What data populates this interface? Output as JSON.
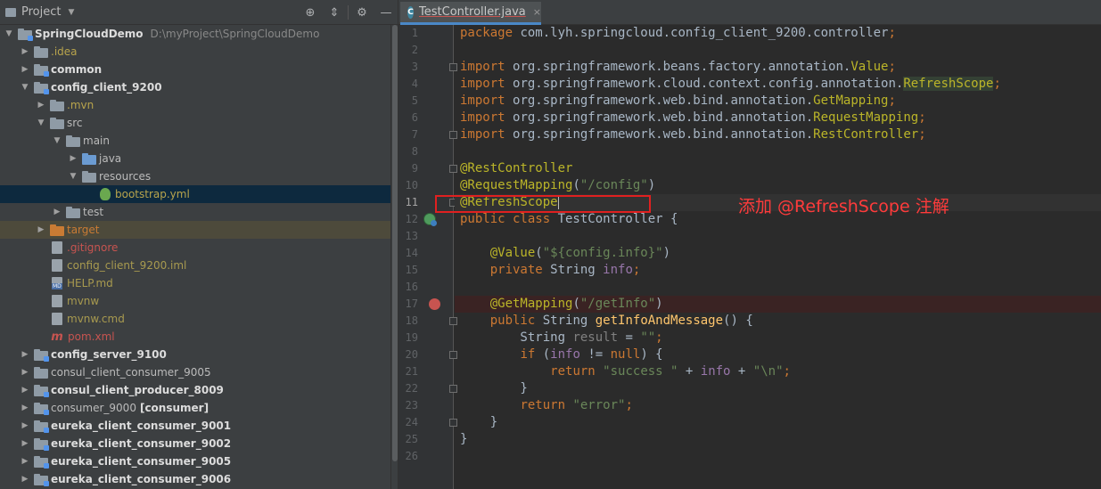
{
  "project": {
    "header_title": "Project",
    "header_dropdown": "▼",
    "tools": [
      "target-icon",
      "collapse-icon",
      "gear-icon",
      "hide-icon"
    ],
    "tree": [
      {
        "label": "SpringCloudDemo",
        "hint": "D:\\myProject\\SpringCloudDemo",
        "style": "bold",
        "arrow": "▼",
        "icon": "module-folder"
      },
      {
        "label": ".idea",
        "style": "yellow",
        "arrow": "▶",
        "icon": "folder"
      },
      {
        "label": "common",
        "style": "bold",
        "arrow": "▶",
        "icon": "module-folder"
      },
      {
        "label": "config_client_9200",
        "style": "bold",
        "arrow": "▼",
        "icon": "module-folder"
      },
      {
        "label": ".mvn",
        "style": "yellow",
        "arrow": "▶",
        "icon": "folder"
      },
      {
        "label": "src",
        "style": "normal",
        "arrow": "▼",
        "icon": "folder"
      },
      {
        "label": "main",
        "style": "normal",
        "arrow": "▼",
        "icon": "folder"
      },
      {
        "label": "java",
        "style": "normal",
        "arrow": "▶",
        "icon": "source-folder"
      },
      {
        "label": "resources",
        "style": "normal",
        "arrow": "▼",
        "icon": "resources-folder"
      },
      {
        "label": "bootstrap.yml",
        "style": "yellow",
        "arrow": "",
        "icon": "yml-file"
      },
      {
        "label": "test",
        "style": "normal",
        "arrow": "▶",
        "icon": "folder"
      },
      {
        "label": "target",
        "style": "orange",
        "arrow": "▶",
        "icon": "excluded-folder"
      },
      {
        "label": ".gitignore",
        "style": "red",
        "arrow": "",
        "icon": "gitignore-file"
      },
      {
        "label": "config_client_9200.iml",
        "style": "olive",
        "arrow": "",
        "icon": "iml-file"
      },
      {
        "label": "HELP.md",
        "style": "olive",
        "arrow": "",
        "icon": "md-file"
      },
      {
        "label": "mvnw",
        "style": "olive",
        "arrow": "",
        "icon": "file"
      },
      {
        "label": "mvnw.cmd",
        "style": "olive",
        "arrow": "",
        "icon": "file"
      },
      {
        "label": "pom.xml",
        "style": "red",
        "arrow": "",
        "icon": "maven-file"
      },
      {
        "label": "config_server_9100",
        "style": "bold",
        "arrow": "▶",
        "icon": "module-folder"
      },
      {
        "label": "consul_client_consumer_9005",
        "style": "normal",
        "arrow": "▶",
        "icon": "folder"
      },
      {
        "label": "consul_client_producer_8009",
        "style": "bold",
        "arrow": "▶",
        "icon": "module-folder"
      },
      {
        "label": "consumer_9000",
        "hint_bold": "[consumer]",
        "style": "normal",
        "arrow": "▶",
        "icon": "module-folder"
      },
      {
        "label": "eureka_client_consumer_9001",
        "style": "bold",
        "arrow": "▶",
        "icon": "module-folder"
      },
      {
        "label": "eureka_client_consumer_9002",
        "style": "bold",
        "arrow": "▶",
        "icon": "module-folder"
      },
      {
        "label": "eureka_client_consumer_9005",
        "style": "bold",
        "arrow": "▶",
        "icon": "module-folder"
      },
      {
        "label": "eureka_client_consumer_9006",
        "style": "bold",
        "arrow": "▶",
        "icon": "module-folder"
      }
    ]
  },
  "editor": {
    "tab_icon": "C",
    "tab_label": "TestController.java",
    "tab_close": "×",
    "current_line": 11,
    "breakpoint_line": 17,
    "bean_line": 12,
    "line_numbers": [
      "1",
      "2",
      "3",
      "4",
      "5",
      "6",
      "7",
      "8",
      "9",
      "10",
      "11",
      "12",
      "13",
      "14",
      "15",
      "16",
      "17",
      "18",
      "19",
      "20",
      "21",
      "22",
      "23",
      "24",
      "25",
      "26"
    ],
    "code": [
      [
        [
          "kw",
          "package "
        ],
        [
          "t",
          "com.lyh.springcloud.config_client_9200.controller"
        ],
        [
          "kw",
          ";"
        ]
      ],
      [],
      [
        [
          "kw",
          "import "
        ],
        [
          "t",
          "org.springframework.beans.factory.annotation."
        ],
        [
          "ann",
          "Value"
        ],
        [
          "kw",
          ";"
        ]
      ],
      [
        [
          "kw",
          "import "
        ],
        [
          "t",
          "org.springframework.cloud.context.config.annotation."
        ],
        [
          "hl",
          "RefreshScope"
        ],
        [
          "kw",
          ";"
        ]
      ],
      [
        [
          "kw",
          "import "
        ],
        [
          "t",
          "org.springframework.web.bind.annotation."
        ],
        [
          "ann",
          "GetMapping"
        ],
        [
          "kw",
          ";"
        ]
      ],
      [
        [
          "kw",
          "import "
        ],
        [
          "t",
          "org.springframework.web.bind.annotation."
        ],
        [
          "ann",
          "RequestMapping"
        ],
        [
          "kw",
          ";"
        ]
      ],
      [
        [
          "kw",
          "import "
        ],
        [
          "t",
          "org.springframework.web.bind.annotation."
        ],
        [
          "ann",
          "RestController"
        ],
        [
          "kw",
          ";"
        ]
      ],
      [],
      [
        [
          "ann",
          "@RestController"
        ]
      ],
      [
        [
          "ann",
          "@RequestMapping"
        ],
        [
          "t",
          "("
        ],
        [
          "str",
          "\"/config\""
        ],
        [
          "t",
          ")"
        ]
      ],
      [
        [
          "ann",
          "@RefreshScope"
        ],
        [
          "caret",
          ""
        ]
      ],
      [
        [
          "kw",
          "public class "
        ],
        [
          "t",
          "TestController {"
        ]
      ],
      [],
      [
        [
          "t",
          "    "
        ],
        [
          "ann",
          "@Value"
        ],
        [
          "t",
          "("
        ],
        [
          "str",
          "\"${config.info}\""
        ],
        [
          "t",
          ")"
        ]
      ],
      [
        [
          "t",
          "    "
        ],
        [
          "kw",
          "private "
        ],
        [
          "t",
          "String "
        ],
        [
          "fld",
          "info"
        ],
        [
          "kw",
          ";"
        ]
      ],
      [],
      [
        [
          "t",
          "    "
        ],
        [
          "ann",
          "@GetMapping"
        ],
        [
          "t",
          "("
        ],
        [
          "str",
          "\"/getInfo\""
        ],
        [
          "t",
          ")"
        ]
      ],
      [
        [
          "t",
          "    "
        ],
        [
          "kw",
          "public "
        ],
        [
          "t",
          "String "
        ],
        [
          "fn",
          "getInfoAndMessage"
        ],
        [
          "t",
          "() {"
        ]
      ],
      [
        [
          "t",
          "        String "
        ],
        [
          "gray",
          "result"
        ],
        [
          "t",
          " = "
        ],
        [
          "str",
          "\"\""
        ],
        [
          "kw",
          ";"
        ]
      ],
      [
        [
          "t",
          "        "
        ],
        [
          "kw",
          "if "
        ],
        [
          "t",
          "("
        ],
        [
          "fld",
          "info"
        ],
        [
          "t",
          " != "
        ],
        [
          "kw",
          "null"
        ],
        [
          "t",
          ") {"
        ]
      ],
      [
        [
          "t",
          "            "
        ],
        [
          "kw",
          "return "
        ],
        [
          "str",
          "\"success \""
        ],
        [
          "t",
          " + "
        ],
        [
          "fld",
          "info"
        ],
        [
          "t",
          " + "
        ],
        [
          "str",
          "\"\\n\""
        ],
        [
          "kw",
          ";"
        ]
      ],
      [
        [
          "t",
          "        }"
        ]
      ],
      [
        [
          "t",
          "        "
        ],
        [
          "kw",
          "return "
        ],
        [
          "str",
          "\"error\""
        ],
        [
          "kw",
          ";"
        ]
      ],
      [
        [
          "t",
          "    }"
        ]
      ],
      [
        [
          "t",
          "}"
        ]
      ],
      []
    ],
    "fold_lines": [
      3,
      7,
      9,
      11,
      18,
      20,
      22,
      24
    ]
  },
  "annotation": {
    "text": "添加  @RefreshScope 注解",
    "color": "#ff3b3b"
  }
}
